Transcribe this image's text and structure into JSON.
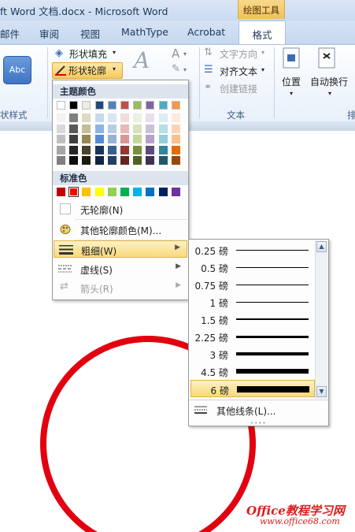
{
  "window": {
    "title": "ft Word 文档.docx - Microsoft Word",
    "context_header": "绘图工具"
  },
  "tabs": [
    "邮件",
    "审阅",
    "视图",
    "MathType",
    "Acrobat",
    "格式"
  ],
  "ribbon": {
    "abc_label": "Abc",
    "fill_label": "形状填充",
    "outline_label": "形状轮廓",
    "text_direction": "文字方向",
    "align_text": "对齐文本",
    "create_link": "创建链接",
    "position": "位置",
    "auto_wrap": "自动换行",
    "group_shape_styles": "状样式",
    "group_text": "文本",
    "group_arrange": "排"
  },
  "menu": {
    "theme_colors_label": "主题颜色",
    "standard_colors_label": "标准色",
    "no_outline": "无轮廓(N)",
    "more_colors": "其他轮廓颜色(M)...",
    "weight": "粗细(W)",
    "dashes": "虚线(S)",
    "arrows": "箭头(R)"
  },
  "theme_colors": {
    "top": [
      "#ffffff",
      "#000000",
      "#eeece1",
      "#1f497d",
      "#4f81bd",
      "#c0504d",
      "#9bbb59",
      "#8064a2",
      "#4bacc6",
      "#f79646"
    ],
    "shades": [
      [
        "#f2f2f2",
        "#d8d8d8",
        "#bfbfbf",
        "#a5a5a5",
        "#7f7f7f"
      ],
      [
        "#7f7f7f",
        "#595959",
        "#3f3f3f",
        "#262626",
        "#0c0c0c"
      ],
      [
        "#ddd9c3",
        "#c4bd97",
        "#938953",
        "#494429",
        "#1d1b10"
      ],
      [
        "#c6d9f0",
        "#8db3e2",
        "#548dd4",
        "#17365d",
        "#0f243e"
      ],
      [
        "#dbe5f1",
        "#b8cce4",
        "#95b3d7",
        "#366092",
        "#244061"
      ],
      [
        "#f2dcdb",
        "#e5b9b7",
        "#d99694",
        "#953734",
        "#632423"
      ],
      [
        "#ebf1dd",
        "#d7e3bc",
        "#c3d69b",
        "#76923c",
        "#4f6128"
      ],
      [
        "#e5e0ec",
        "#ccc1d9",
        "#b2a2c7",
        "#5f497a",
        "#3f3151"
      ],
      [
        "#dbeef3",
        "#b7dde8",
        "#92cddc",
        "#31859b",
        "#205867"
      ],
      [
        "#fdeada",
        "#fbd5b5",
        "#fac08f",
        "#e36c09",
        "#974806"
      ]
    ]
  },
  "standard_colors": [
    "#c00000",
    "#ff0000",
    "#ffc000",
    "#ffff00",
    "#92d050",
    "#00b050",
    "#00b0f0",
    "#0070c0",
    "#002060",
    "#7030a0"
  ],
  "weights": [
    {
      "label": "0.25 磅",
      "pt": 0.25
    },
    {
      "label": "0.5 磅",
      "pt": 0.5
    },
    {
      "label": "0.75 磅",
      "pt": 0.75
    },
    {
      "label": "1 磅",
      "pt": 1
    },
    {
      "label": "1.5 磅",
      "pt": 1.5
    },
    {
      "label": "2.25 磅",
      "pt": 2.25
    },
    {
      "label": "3 磅",
      "pt": 3
    },
    {
      "label": "4.5 磅",
      "pt": 4.5
    },
    {
      "label": "6 磅",
      "pt": 6
    }
  ],
  "selected_weight": "6 磅",
  "more_lines": "其他线条(L)...",
  "watermark": {
    "line1": "Office教程学习网",
    "line2": "www.office68.com"
  },
  "colors": {
    "shape_outline": "#e3000f"
  }
}
